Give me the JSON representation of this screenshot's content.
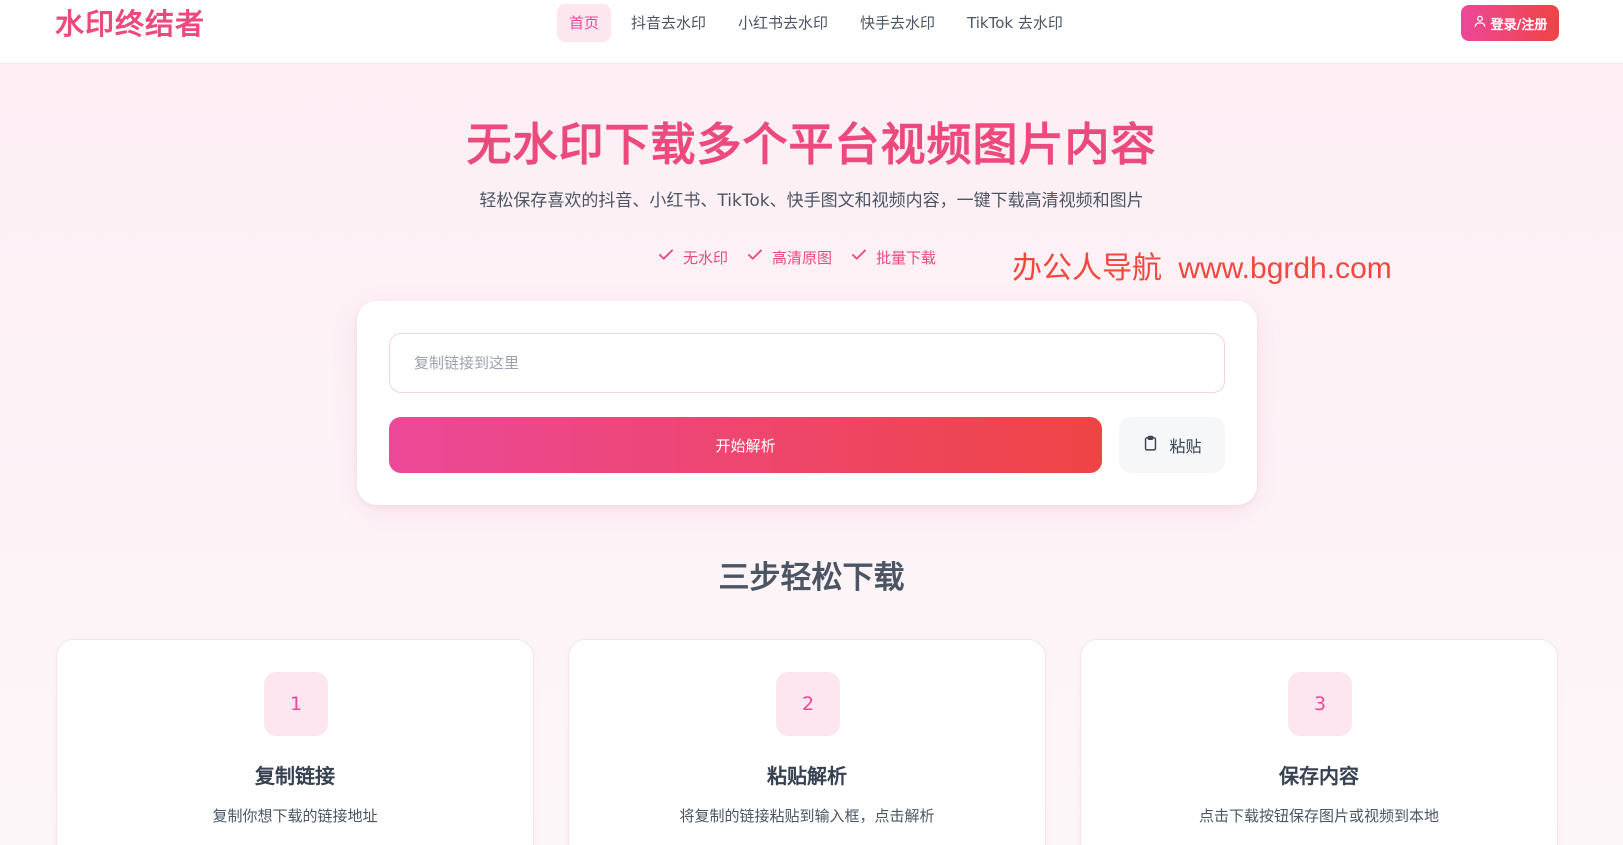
{
  "brand": {
    "logo_text": "水印终结者",
    "accent": "#ec4a7d",
    "gradient_from": "#ec4899",
    "gradient_to": "#ef4444"
  },
  "nav": {
    "links": [
      {
        "label": "首页",
        "active": true
      },
      {
        "label": "抖音去水印",
        "active": false
      },
      {
        "label": "小红书去水印",
        "active": false
      },
      {
        "label": "快手去水印",
        "active": false
      },
      {
        "label": "TikTok 去水印",
        "active": false
      }
    ],
    "login_label": "登录/注册",
    "login_icon": "user-icon"
  },
  "hero": {
    "title": "无水印下载多个平台视频图片内容",
    "subtitle": "轻松保存喜欢的抖音、小红书、TikTok、快手图文和视频内容，一键下载高清视频和图片",
    "features": [
      "无水印",
      "高清原图",
      "批量下载"
    ],
    "feature_icon": "check-icon"
  },
  "watermark_text": "办公人导航  www.bgrdh.com",
  "parser": {
    "input_placeholder": "复制链接到这里",
    "input_value": "",
    "parse_label": "开始解析",
    "paste_label": "粘贴",
    "paste_icon": "clipboard-icon"
  },
  "steps": {
    "title": "三步轻松下载",
    "items": [
      {
        "num": "1",
        "title": "复制链接",
        "desc": "复制你想下载的链接地址"
      },
      {
        "num": "2",
        "title": "粘贴解析",
        "desc": "将复制的链接粘贴到输入框，点击解析"
      },
      {
        "num": "3",
        "title": "保存内容",
        "desc": "点击下载按钮保存图片或视频到本地"
      }
    ]
  }
}
